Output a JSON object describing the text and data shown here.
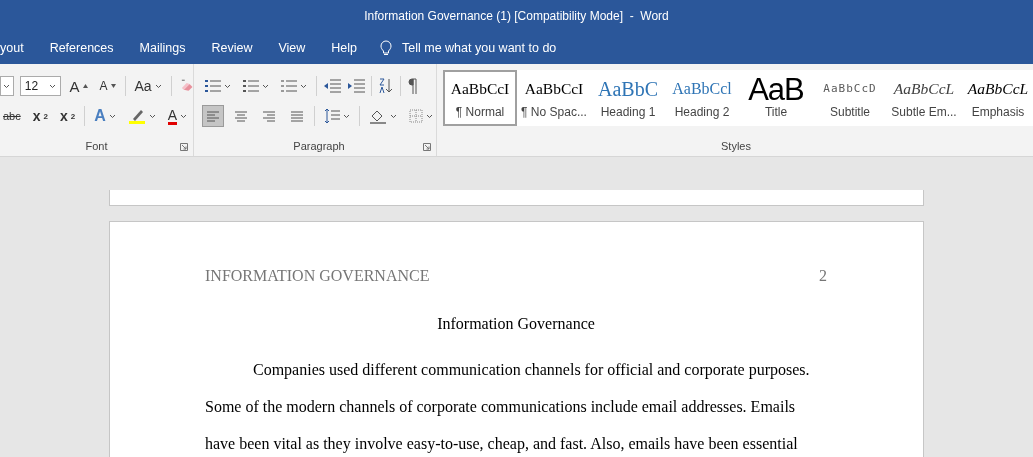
{
  "window": {
    "title": "Information Governance (1) [Compatibility Mode]  -  Word"
  },
  "tabs": [
    {
      "label": "yout",
      "selected": false
    },
    {
      "label": "References",
      "selected": false
    },
    {
      "label": "Mailings",
      "selected": false
    },
    {
      "label": "Review",
      "selected": false
    },
    {
      "label": "View",
      "selected": false
    },
    {
      "label": "Help",
      "selected": false
    }
  ],
  "tell_me": {
    "placeholder": "Tell me what you want to do"
  },
  "font_group": {
    "label": "Font",
    "font_size": "12",
    "grow": "A",
    "shrink": "A",
    "change_case": "Aa",
    "strikethrough": "abc",
    "subscript": "x",
    "subscript_mark": "2",
    "superscript": "x",
    "superscript_mark": "2",
    "text_effects": "A",
    "font_color": "A"
  },
  "paragraph_group": {
    "label": "Paragraph",
    "alignments": [
      {
        "kind": "left",
        "selected": true
      },
      {
        "kind": "center",
        "selected": false
      },
      {
        "kind": "right",
        "selected": false
      },
      {
        "kind": "justify",
        "selected": false
      }
    ]
  },
  "styles_group": {
    "label": "Styles",
    "styles": [
      {
        "kind": "normal",
        "preview": "AaBbCcI",
        "label": "¶ Normal",
        "selected": true
      },
      {
        "kind": "normal",
        "preview": "AaBbCcI",
        "label": "¶ No Spac...",
        "selected": false
      },
      {
        "kind": "heading1",
        "preview": "AaBbC",
        "label": "Heading 1",
        "selected": false
      },
      {
        "kind": "heading2",
        "preview": "AaBbCcl",
        "label": "Heading 2",
        "selected": false
      },
      {
        "kind": "title",
        "preview": "AaB",
        "label": "Title",
        "selected": false
      },
      {
        "kind": "subtitle",
        "preview": "AaBbCcD",
        "label": "Subtitle",
        "selected": false
      },
      {
        "kind": "subtle",
        "preview": "AaBbCcL",
        "label": "Subtle Em...",
        "selected": false
      },
      {
        "kind": "emphasis",
        "preview": "AaBbCcL",
        "label": "Emphasis",
        "selected": false
      }
    ]
  },
  "document": {
    "header": "INFORMATION GOVERNANCE",
    "page_number": "2",
    "title": "Information Governance",
    "paragraph_lines": [
      "Companies used different communication channels for official and corporate purposes.",
      "Some of the modern channels of corporate communications include email addresses. Emails",
      "have been vital as they involve easy-to-use, cheap, and fast. Also, emails have been essential"
    ]
  }
}
